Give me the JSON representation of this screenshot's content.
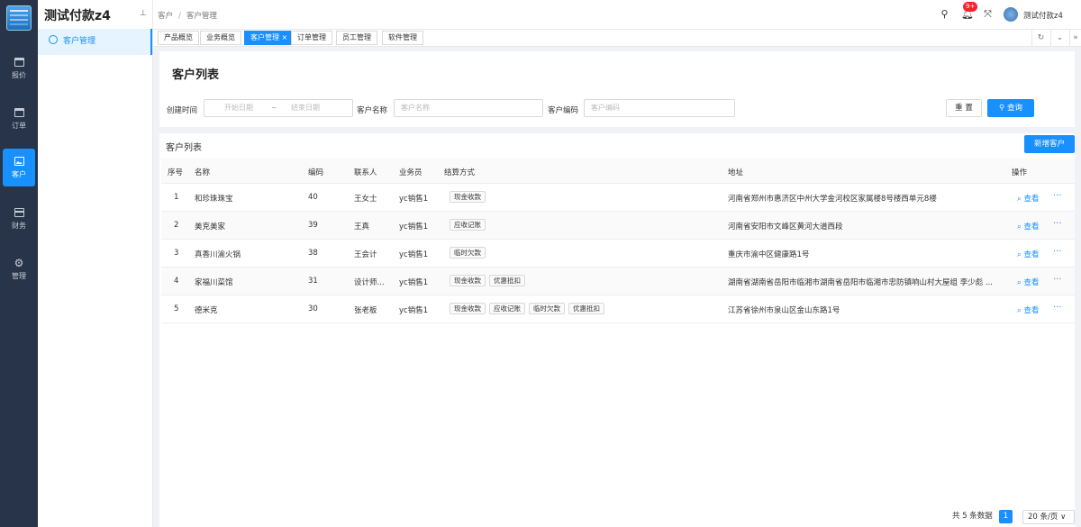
{
  "app": {
    "title": "测试付款z4",
    "user": "测试付款z4",
    "notifications": "9+"
  },
  "rail": {
    "items": [
      {
        "label": "报价",
        "icon": "calendar-icon"
      },
      {
        "label": "订单",
        "icon": "calendar-icon"
      },
      {
        "label": "客户",
        "icon": "image-icon",
        "active": true
      },
      {
        "label": "财务",
        "icon": "card-icon"
      },
      {
        "label": "管理",
        "icon": "gear-icon"
      }
    ]
  },
  "sidebar": {
    "items": [
      {
        "label": "客户管理",
        "active": true
      }
    ]
  },
  "breadcrumb": {
    "root": "客户",
    "current": "客户管理"
  },
  "tabs": [
    {
      "label": "产品概览"
    },
    {
      "label": "业务概览"
    },
    {
      "label": "客户管理 ×",
      "active": true
    },
    {
      "label": "订单管理"
    },
    {
      "label": "员工管理"
    },
    {
      "label": "软件管理"
    }
  ],
  "filter": {
    "title": "客户列表",
    "created_label": "创建时间",
    "start_placeholder": "开始日期",
    "range_sep": "~",
    "end_placeholder": "结束日期",
    "name_label": "客户名称",
    "name_placeholder": "客户名称",
    "code_label": "客户编码",
    "code_placeholder": "客户编码",
    "reset": "重 置",
    "search": "查询"
  },
  "table": {
    "title": "客户列表",
    "add": "新增客户",
    "headers": [
      "序号",
      "名称",
      "编码",
      "联系人",
      "业务员",
      "结算方式",
      "地址",
      "操作"
    ],
    "rows": [
      {
        "no": "1",
        "name": "和珍珠珠宝",
        "code": "40",
        "contact": "王女士",
        "sales": "yc销售1",
        "methods": [
          "现金收款"
        ],
        "address": "河南省郑州市惠济区中州大学金河校区家属楼8号楼西单元8楼"
      },
      {
        "no": "2",
        "name": "美克美家",
        "code": "39",
        "contact": "王真",
        "sales": "yc销售1",
        "methods": [
          "应收记账"
        ],
        "address": "河南省安阳市文峰区黄河大道西段"
      },
      {
        "no": "3",
        "name": "真香川渝火锅",
        "code": "38",
        "contact": "王会计",
        "sales": "yc销售1",
        "methods": [
          "临时欠款"
        ],
        "address": "重庆市渝中区健康路1号"
      },
      {
        "no": "4",
        "name": "家福川菜馆",
        "code": "31",
        "contact": "设计师...",
        "sales": "yc销售1",
        "methods": [
          "现金收款",
          "优惠抵扣"
        ],
        "address": "湖南省湖南省岳阳市临湘市湖南省岳阳市临湘市忠防镇响山村大屋组 李少彪 ..."
      },
      {
        "no": "5",
        "name": "德米克",
        "code": "30",
        "contact": "张老板",
        "sales": "yc销售1",
        "methods": [
          "现金收款",
          "应收记账",
          "临时欠款",
          "优惠抵扣"
        ],
        "address": "江苏省徐州市泉山区金山东路1号"
      }
    ],
    "view": "查看",
    "more": "···"
  },
  "pager": {
    "total": "共 5 条数据",
    "page": "1",
    "size": "20 条/页 ∨"
  }
}
